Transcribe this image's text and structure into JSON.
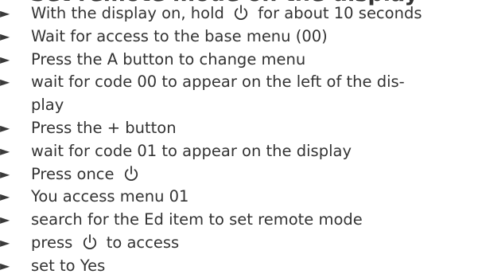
{
  "heading": "Set remote mode on the display",
  "bullet_glyph": "►",
  "steps": [
    {
      "text_before": "With the display on, hold",
      "icon": "power-icon",
      "text_after": "for about 10 seconds"
    },
    {
      "text": "Wait for access to the base menu (00)"
    },
    {
      "text": "Press the A button to change menu"
    },
    {
      "line1": "wait for code 00 to appear on the left of the dis-",
      "line2": "play"
    },
    {
      "text": "Press the + button"
    },
    {
      "text": "wait for code 01 to appear on the display"
    },
    {
      "text_before": "Press once",
      "icon": "power-icon"
    },
    {
      "text": "You access menu 01"
    },
    {
      "text": "search for the Ed item to set remote mode"
    },
    {
      "text_before": "press",
      "icon": "power-icon",
      "text_after": "to access"
    },
    {
      "text": "set to Yes"
    }
  ]
}
